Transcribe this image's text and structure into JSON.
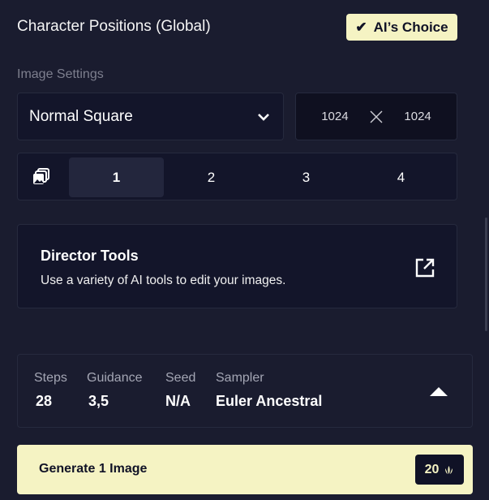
{
  "header": {
    "title": "Character Positions (Global)",
    "ai_choice_label": "AI’s Choice"
  },
  "image_settings": {
    "label": "Image Settings",
    "preset": "Normal Square",
    "width": "1024",
    "height": "1024",
    "image_counts": [
      "1",
      "2",
      "3",
      "4"
    ],
    "selected_count": "1"
  },
  "director_tools": {
    "title": "Director Tools",
    "description": "Use a variety of AI tools to edit your images."
  },
  "generation_settings": {
    "steps_label": "Steps",
    "steps": "28",
    "guidance_label": "Guidance",
    "guidance": "3,5",
    "seed_label": "Seed",
    "seed": "N/A",
    "sampler_label": "Sampler",
    "sampler": "Euler Ancestral"
  },
  "generate": {
    "label": "Generate 1 Image",
    "cost": "20"
  },
  "colors": {
    "background": "#1a1c2f",
    "accent": "#f5f3c3",
    "panel": "#13152a"
  }
}
